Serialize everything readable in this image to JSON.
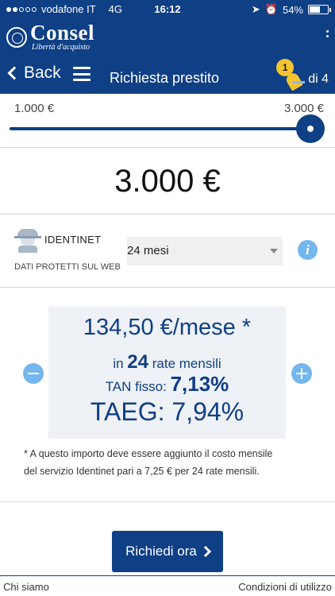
{
  "status_bar": {
    "carrier": "vodafone IT",
    "network": "4G",
    "time": "16:12",
    "battery": "54%",
    "signal_bars_filled": 2,
    "signal_bars_total": 5,
    "battery_level": 0.54
  },
  "brand": {
    "name": "Consel",
    "tagline": "Libertà d'acquisto"
  },
  "nav": {
    "back_label": "Back",
    "title": "Richiesta prestito",
    "step_number": "1",
    "step_total": "di 4"
  },
  "slider": {
    "min_label": "1.000 €",
    "max_label": "3.000 €",
    "value_fraction": 1.0
  },
  "amount": "3.000 €",
  "identinet": {
    "name": "IDENTINET",
    "subtitle": "DATI PROTETTI SUL WEB"
  },
  "duration_select": {
    "value": "24 mesi"
  },
  "rate": {
    "monthly": "134,50 €/mese *",
    "rates_prefix": "in",
    "rates_count": "24",
    "rates_suffix": "rate mensili",
    "tan_label": "TAN fisso:",
    "tan_value": "7,13%",
    "taeg": "TAEG: 7,94%"
  },
  "note": "* A questo importo deve essere aggiunto il costo mensile del servizio Identinet pari a 7,25 € per 24 rate mensili.",
  "cta_label": "Richiedi ora",
  "footer": {
    "left": "Chi siamo",
    "right": "Condizioni di utilizzo"
  },
  "colors": {
    "primary": "#0f3f84",
    "accent": "#74b6ee",
    "box_bg": "#eef1f6",
    "step_badge": "#f4c430"
  }
}
